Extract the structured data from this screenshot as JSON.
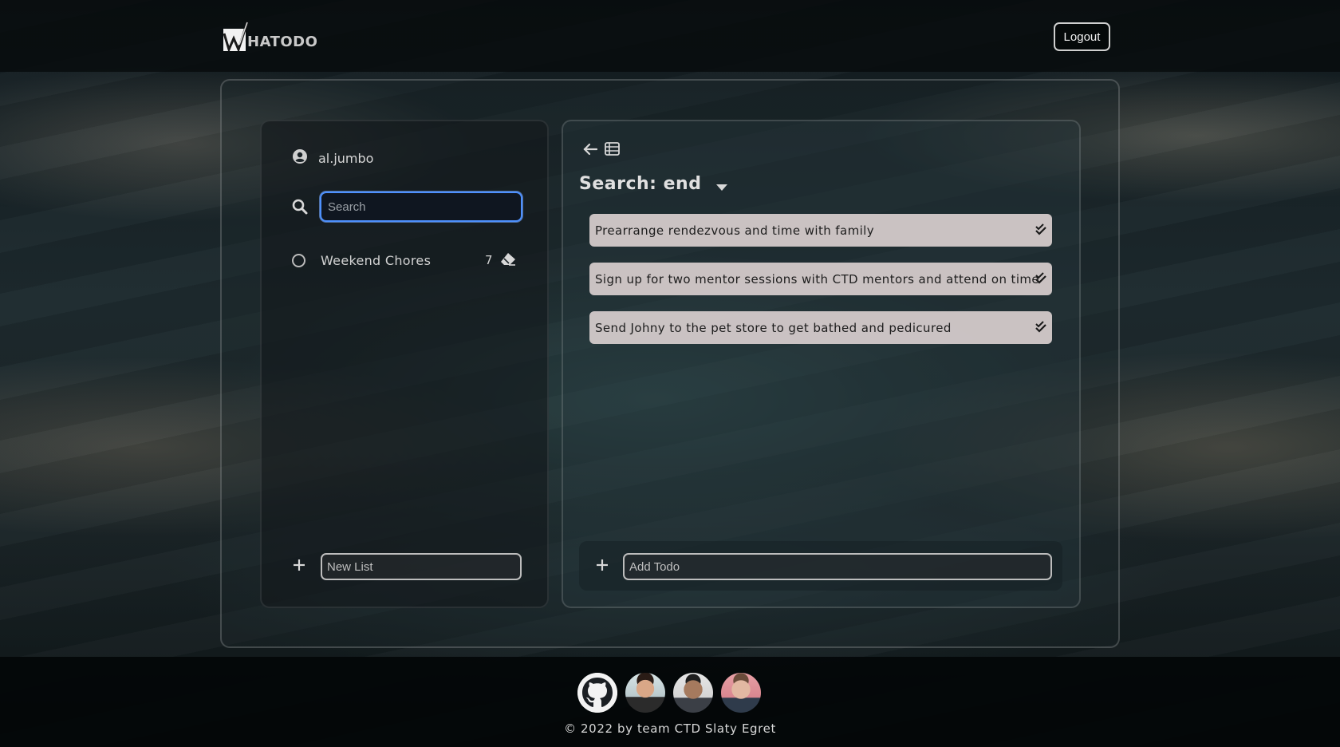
{
  "header": {
    "logo_text": "HATODO",
    "logout_label": "Logout"
  },
  "sidebar": {
    "username": "al.jumbo",
    "search_placeholder": "Search",
    "lists": [
      {
        "name": "Weekend Chores",
        "count": "7"
      }
    ],
    "new_list_placeholder": "New List"
  },
  "main": {
    "title": "Search: end",
    "todos": [
      {
        "text": "Prearrange rendezvous and time with family"
      },
      {
        "text": "Sign up for two mentor sessions with CTD mentors and attend on time"
      },
      {
        "text": "Send Johny to the pet store to get bathed and pedicured"
      }
    ],
    "add_todo_placeholder": "Add Todo"
  },
  "footer": {
    "copyright": "© 2022 by team CTD Slaty Egret"
  },
  "colors": {
    "accent_focus": "#4d90fe",
    "todo_bg": "#d7cdcd"
  }
}
